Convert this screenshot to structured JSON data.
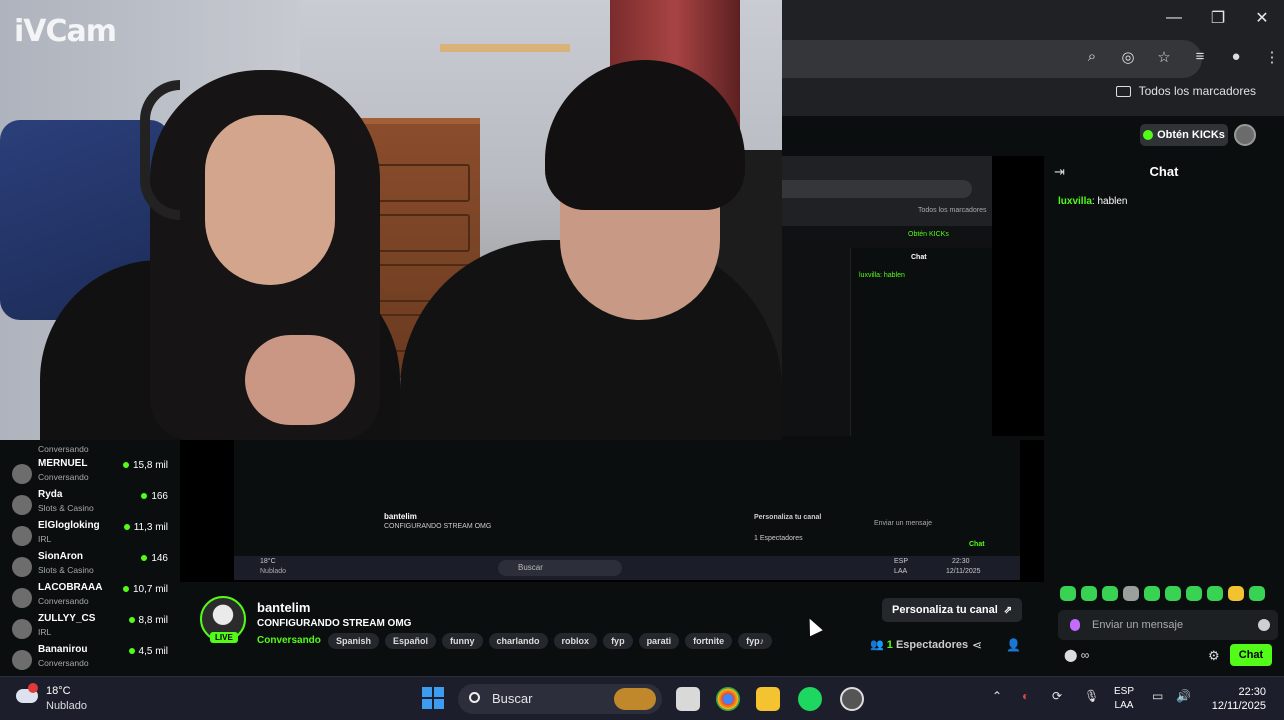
{
  "overlay_logo": "iVCam",
  "browser": {
    "bookmarks_label": "Todos los marcadores"
  },
  "header": {
    "kicks_label": "Obtén KICKs"
  },
  "chat": {
    "title": "Chat",
    "messages": [
      {
        "user": "luxvilla",
        "text": "hablen"
      }
    ],
    "input_placeholder": "Enviar un mensaje",
    "send_label": "Chat",
    "footer_count": "∞"
  },
  "sidebar": {
    "top_category": "Conversando",
    "items": [
      {
        "name": "MERNUEL",
        "category": "Conversando",
        "viewers": "15,8 mil"
      },
      {
        "name": "Ryda",
        "category": "Slots & Casino",
        "viewers": "166"
      },
      {
        "name": "ElGlogloking",
        "category": "IRL",
        "viewers": "11,3 mil"
      },
      {
        "name": "SionAron",
        "category": "Slots & Casino",
        "viewers": "146"
      },
      {
        "name": "LACOBRAAA",
        "category": "Conversando",
        "viewers": "10,7 mil"
      },
      {
        "name": "ZULLYY_CS",
        "category": "IRL",
        "viewers": "8,8 mil"
      },
      {
        "name": "Bananirou",
        "category": "Conversando",
        "viewers": "4,5 mil"
      }
    ]
  },
  "stream": {
    "streamer": "bantelim",
    "live_badge": "LIVE",
    "title": "CONFIGURANDO STREAM OMG",
    "category": "Conversando",
    "tags": [
      "Spanish",
      "Español",
      "funny",
      "charlando",
      "roblox",
      "fyp",
      "parati",
      "fortnite",
      "fyp♪"
    ],
    "customize_label": "Personaliza tu canal",
    "viewers_count": "1",
    "viewers_label": "Espectadores"
  },
  "nested": {
    "chat_title": "Chat",
    "chat_line": "luxvilla: hablen",
    "kicks": "Obtén KICKs",
    "bookmarks": "Todos los marcadores",
    "streamer": "bantelim",
    "title": "CONFIGURANDO STREAM OMG",
    "customize": "Personaliza tu canal",
    "viewers": "1 Espectadores",
    "search": "Buscar",
    "input": "Enviar un mensaje",
    "send": "Chat",
    "weather": "18°C",
    "weather_cond": "Nublado",
    "lang1": "ESP",
    "lang2": "LAA",
    "time": "22:30",
    "date": "12/11/2025"
  },
  "taskbar": {
    "temp": "18°C",
    "condition": "Nublado",
    "search_label": "Buscar",
    "lang_top": "ESP",
    "lang_bottom": "LAA",
    "time": "22:30",
    "date": "12/11/2025"
  },
  "colors": {
    "kick_green": "#53fc18",
    "bg": "#0b0e0f",
    "taskbar": "#1c1f2b"
  }
}
